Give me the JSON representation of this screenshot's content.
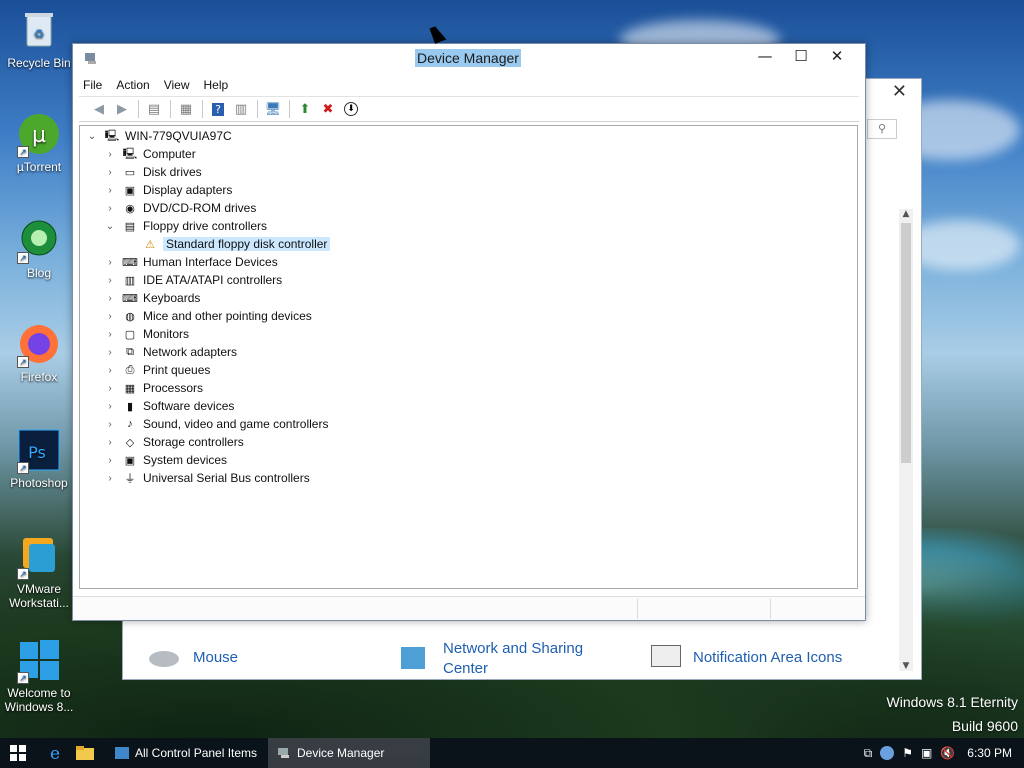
{
  "desktop": {
    "icons": [
      {
        "label": "Recycle Bin"
      },
      {
        "label": "µTorrent"
      },
      {
        "label": "Blog"
      },
      {
        "label": "Firefox"
      },
      {
        "label": "Photoshop"
      },
      {
        "label": "VMware Workstati..."
      },
      {
        "label": "Welcome to Windows 8..."
      }
    ],
    "watermark_line1": "Windows 8.1 Eternity",
    "watermark_line2": "Build 9600"
  },
  "control_panel": {
    "items": [
      "Mouse",
      "Network and Sharing Center",
      "Notification Area Icons"
    ]
  },
  "device_manager": {
    "title": "Device Manager",
    "menu": [
      "File",
      "Action",
      "View",
      "Help"
    ],
    "root": "WIN-779QVUIA97C",
    "categories": [
      "Computer",
      "Disk drives",
      "Display adapters",
      "DVD/CD-ROM drives",
      "Floppy drive controllers",
      "Standard floppy disk controller",
      "Human Interface Devices",
      "IDE ATA/ATAPI controllers",
      "Keyboards",
      "Mice and other pointing devices",
      "Monitors",
      "Network adapters",
      "Print queues",
      "Processors",
      "Software devices",
      "Sound, video and game controllers",
      "Storage controllers",
      "System devices",
      "Universal Serial Bus controllers"
    ]
  },
  "taskbar": {
    "tasks": [
      "All Control Panel Items",
      "Device Manager"
    ],
    "clock": "6:30 PM"
  }
}
